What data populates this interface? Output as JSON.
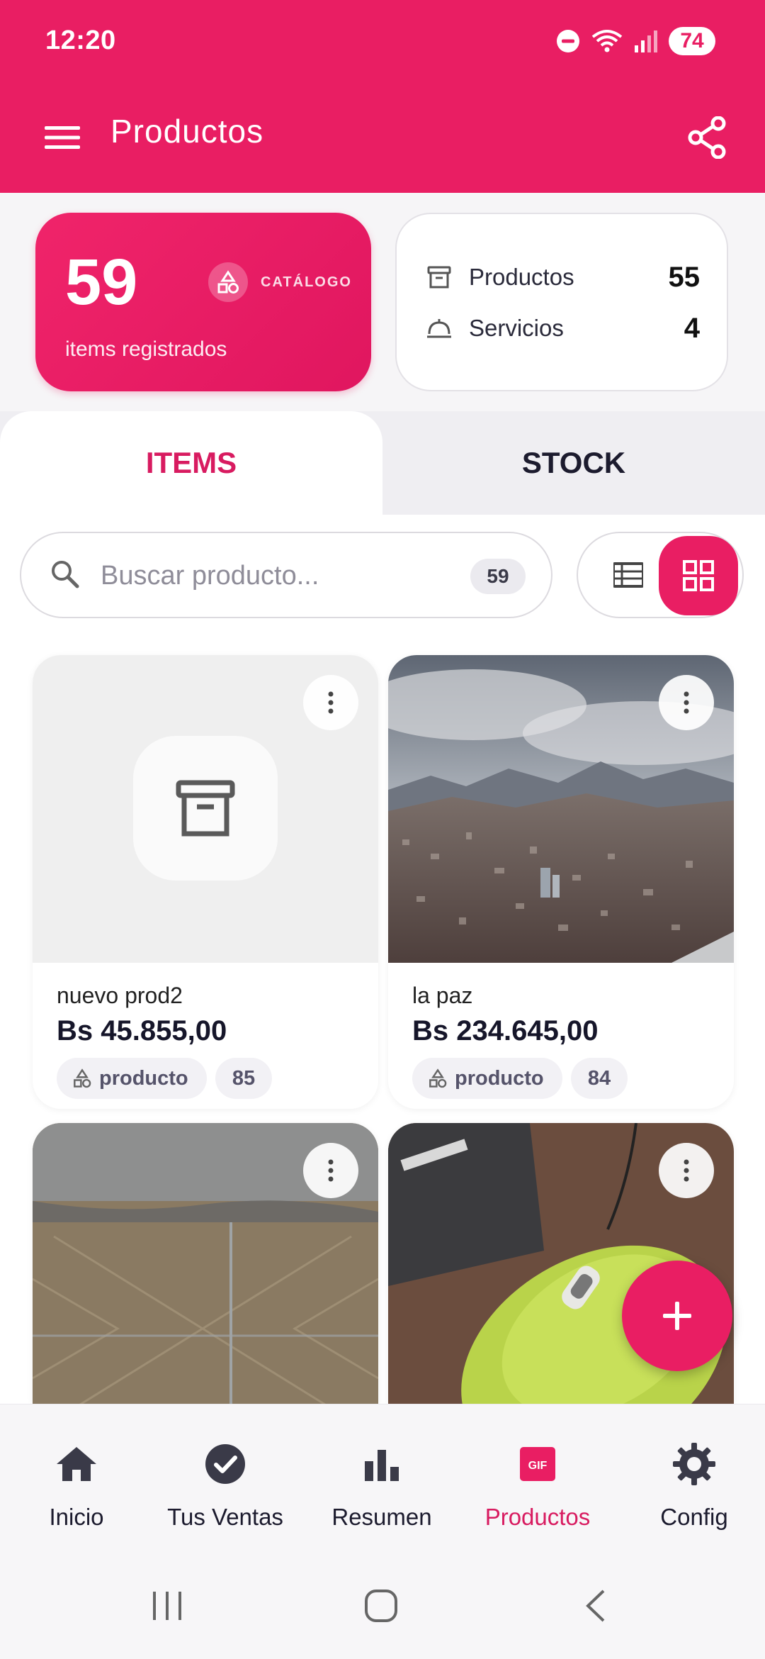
{
  "status_bar": {
    "time": "12:20",
    "battery": "74"
  },
  "app_bar": {
    "title": "Productos"
  },
  "summary": {
    "count": "59",
    "count_label": "items registrados",
    "catalog_label": "CATÁLOGO",
    "products_label": "Productos",
    "products_count": "55",
    "services_label": "Servicios",
    "services_count": "4"
  },
  "tabs": [
    {
      "label": "ITEMS",
      "active": true
    },
    {
      "label": "STOCK",
      "active": false
    }
  ],
  "search": {
    "placeholder": "Buscar producto...",
    "value": "",
    "count": "59"
  },
  "view_mode": "grid",
  "products": [
    {
      "name": "nuevo prod2",
      "price": "Bs 45.855,00",
      "type": "producto",
      "stock": "85",
      "image": "placeholder-box-icon"
    },
    {
      "name": "la paz",
      "price": "Bs 234.645,00",
      "type": "producto",
      "stock": "84",
      "image": "city-landscape-photo"
    },
    {
      "name": "",
      "price": "",
      "type": "",
      "stock": "",
      "image": "tile-floor-photo"
    },
    {
      "name": "",
      "price": "",
      "type": "",
      "stock": "",
      "image": "green-mouse-photo"
    }
  ],
  "bottom_nav": [
    {
      "label": "Inicio",
      "icon": "home-icon",
      "active": false
    },
    {
      "label": "Tus Ventas",
      "icon": "check-circle-icon",
      "active": false
    },
    {
      "label": "Resumen",
      "icon": "bar-chart-icon",
      "active": false
    },
    {
      "label": "Productos",
      "icon": "gif-icon",
      "active": true
    },
    {
      "label": "Config",
      "icon": "gear-icon",
      "active": false
    }
  ],
  "colors": {
    "accent": "#e91e63",
    "accent_dark": "#d81b60"
  }
}
